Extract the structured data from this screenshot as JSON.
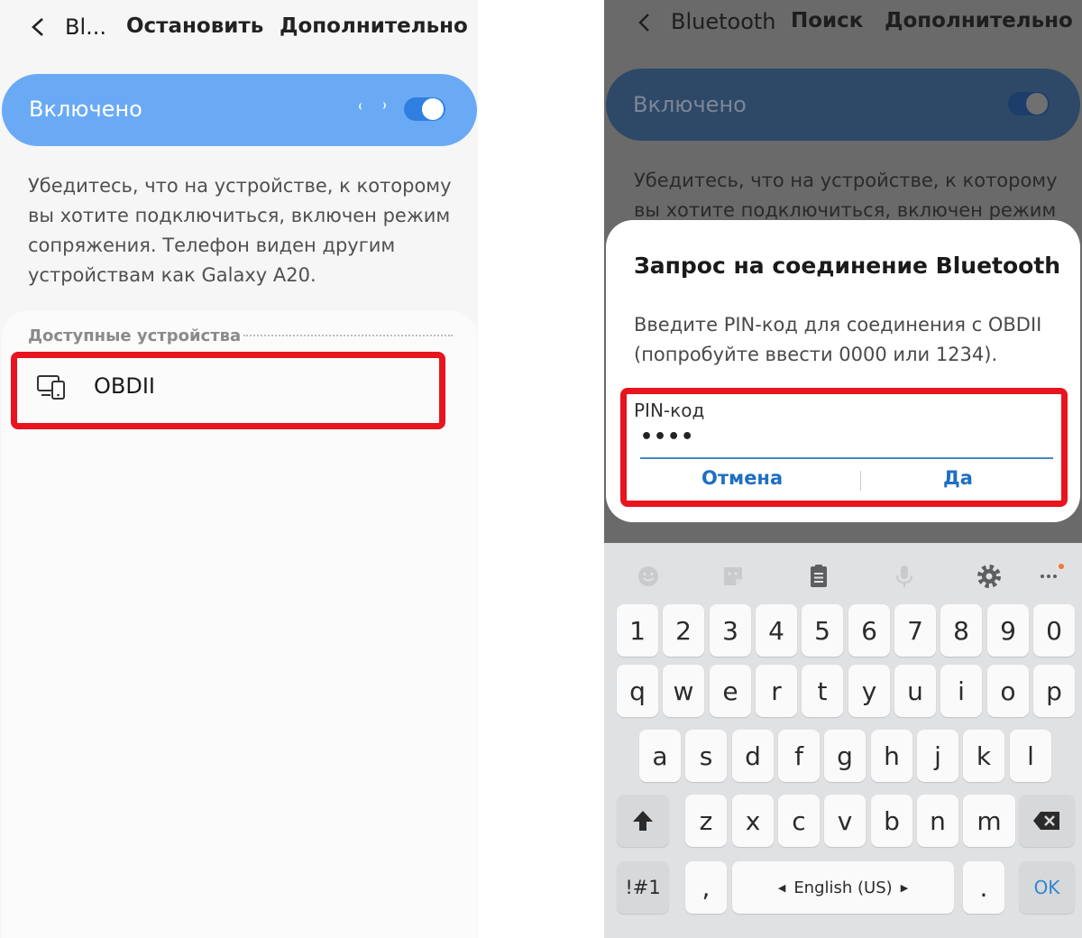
{
  "left": {
    "header": {
      "title": "Bl...",
      "stop_label": "Остановить",
      "more_label": "Дополнительно"
    },
    "toggle": {
      "label": "Включено",
      "state": "on"
    },
    "description": "Убедитесь, что на устройстве, к которому вы хотите подключиться, включен режим сопряжения. Телефон виден другим устройствам как Galaxy A20.",
    "available": {
      "title": "Доступные устройства",
      "devices": [
        {
          "name": "OBDII",
          "icon": "device-icon"
        }
      ]
    }
  },
  "right": {
    "header": {
      "title": "Bluetooth",
      "search_label": "Поиск",
      "more_label": "Дополнительно"
    },
    "toggle": {
      "label": "Включено",
      "state": "on"
    },
    "description": "Убедитесь, что на устройстве, к которому вы хотите подключиться, включен режим",
    "dialog": {
      "title": "Запрос на соединение Bluetooth",
      "message": "Введите PIN-код для соединения с OBDII (попробуйте ввести 0000 или 1234).",
      "pin_label": "PIN-код",
      "pin_value": "••••",
      "cancel_label": "Отмена",
      "ok_label": "Да"
    },
    "keyboard": {
      "toolbar": [
        "emoji-icon",
        "sticker-icon",
        "clipboard-icon",
        "mic-icon",
        "gear-icon",
        "more-icon"
      ],
      "row_numbers": [
        "1",
        "2",
        "3",
        "4",
        "5",
        "6",
        "7",
        "8",
        "9",
        "0"
      ],
      "row_top": [
        "q",
        "w",
        "e",
        "r",
        "t",
        "y",
        "u",
        "i",
        "o",
        "p"
      ],
      "row_mid": [
        "a",
        "s",
        "d",
        "f",
        "g",
        "h",
        "j",
        "k",
        "l"
      ],
      "row_bottom": [
        "z",
        "x",
        "c",
        "v",
        "b",
        "n",
        "m"
      ],
      "symbols_label": "!#1",
      "comma_label": ",",
      "space_label": "English (US)",
      "period_label": ".",
      "ok_label": "OK"
    }
  },
  "colors": {
    "highlight": "#e8141e",
    "accent": "#2f7fe0",
    "link": "#1f6fc2"
  }
}
